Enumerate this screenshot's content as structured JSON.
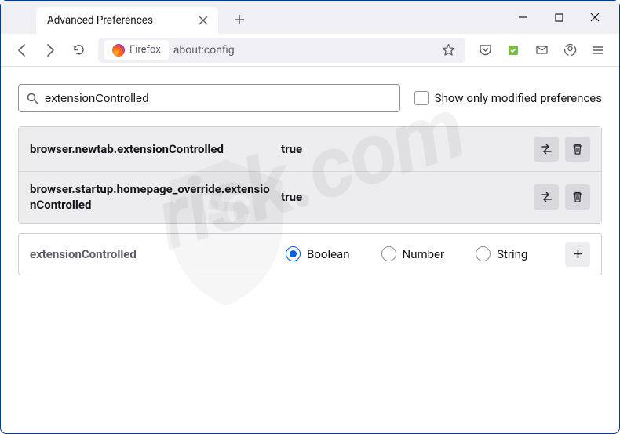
{
  "tab": {
    "title": "Advanced Preferences"
  },
  "identity": {
    "label": "Firefox"
  },
  "url": "about:config",
  "search": {
    "value": "extensionControlled"
  },
  "modified_only_label": "Show only modified preferences",
  "prefs": [
    {
      "name": "browser.newtab.extensionControlled",
      "value": "true"
    },
    {
      "name": "browser.startup.homepage_override.extensionControlled",
      "value": "true"
    }
  ],
  "new_pref": {
    "name": "extensionControlled",
    "types": [
      "Boolean",
      "Number",
      "String"
    ],
    "selected": 0
  },
  "watermark": "risk.com"
}
